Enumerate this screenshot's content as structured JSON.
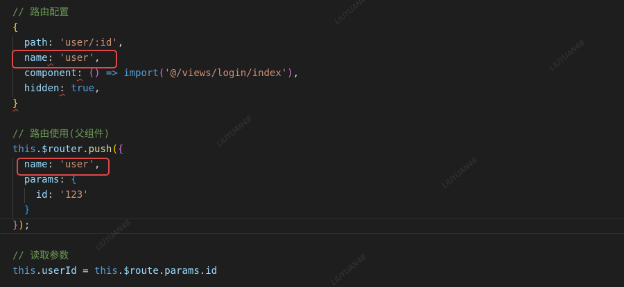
{
  "code": {
    "c1": "// 路由配置",
    "open_brace": "{",
    "path_key": "path",
    "path_val": "'user/:id'",
    "name_key": "name",
    "name_val": "'user'",
    "component_key": "component",
    "arrow_parens": "()",
    "arrow": "=>",
    "import_fn": "import",
    "import_path": "'@/views/login/index'",
    "hidden_key": "hidden",
    "hidden_val": "true",
    "close_brace": "}",
    "c2": "// 路由使用(父组件)",
    "this_kw": "this",
    "router_prop": "$router",
    "push_fn": "push",
    "name2_key": "name",
    "name2_val": "'user'",
    "params_key": "params",
    "id_key": "id",
    "id_val": "'123'",
    "c3": "// 读取参数",
    "this2_kw": "this",
    "userId_prop": "userId",
    "this3_kw": "this",
    "route_prop": "$route",
    "params_prop": "params",
    "id_prop": "id"
  },
  "watermark_text": "LIUYUAN48",
  "colors": {
    "background": "#1e1e1e",
    "comment": "#6a9955",
    "string": "#ce9178",
    "keyword": "#569cd6",
    "property": "#9cdcfe",
    "function": "#dcdcaa",
    "highlight_box": "#e04848"
  }
}
